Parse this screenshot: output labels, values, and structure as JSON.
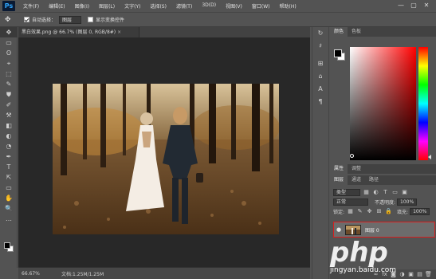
{
  "menubar": {
    "logo": "Ps",
    "items": [
      "文件(F)",
      "编辑(E)",
      "图像(I)",
      "图层(L)",
      "文字(Y)",
      "选择(S)",
      "滤镜(T)",
      "3D(D)",
      "视图(V)",
      "窗口(W)",
      "帮助(H)"
    ],
    "win_controls": [
      "—",
      "▢",
      "✕"
    ]
  },
  "options": {
    "move_glyph": "✥",
    "auto_select_label": "自动选择：",
    "auto_select_value": "图层",
    "show_transform_label": "显示变换控件"
  },
  "document": {
    "tab_title": "黑白效果.png @ 66.7% (图层 0, RGB/8#)",
    "close_glyph": "×",
    "zoom": "66.67%",
    "doc_info": "文档:1.25M/1.25M"
  },
  "tools": [
    "✥",
    "▭",
    "ʘ",
    "⌖",
    "⬚",
    "✎",
    "⛊",
    "✐",
    "⚒",
    "◧",
    "◐",
    "◔",
    "✒",
    "T",
    "⇱",
    "▭",
    "✋",
    "🔍",
    "…"
  ],
  "mini_panel": [
    "↻",
    "♯",
    "⊞",
    "⌂",
    "A",
    "¶"
  ],
  "color_panel": {
    "tabs": [
      "颜色",
      "色板"
    ]
  },
  "adjust_panel": {
    "tabs": [
      "属性",
      "调整"
    ]
  },
  "layers_panel": {
    "tabs": [
      "图层",
      "通道",
      "路径"
    ],
    "filter_label": "类型",
    "blend_mode": "正常",
    "opacity_label": "不透明度:",
    "opacity_value": "100%",
    "lock_label": "锁定:",
    "fill_label": "填充:",
    "fill_value": "100%",
    "layer_name": "图层 0",
    "eye_glyph": "●",
    "footer_icons": [
      "∞",
      "fx",
      "◙",
      "◑",
      "▣",
      "▤",
      "🗑"
    ]
  },
  "watermark": {
    "logo": "php",
    "domain": "jingyan.baidu.com"
  }
}
